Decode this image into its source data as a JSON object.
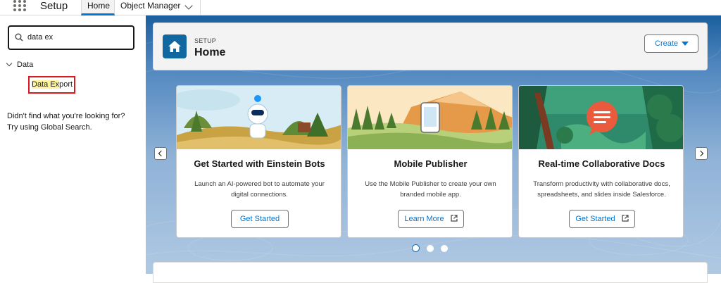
{
  "topbar": {
    "app_name": "Setup",
    "tabs": [
      {
        "label": "Home",
        "active": true
      },
      {
        "label": "Object Manager",
        "has_dropdown": true
      }
    ]
  },
  "sidebar": {
    "search": {
      "value": "data ex"
    },
    "tree": {
      "parent_label": "Data",
      "child_label_match": "Data Ex",
      "child_label_rest": "port"
    },
    "help_line1": "Didn't find what you're looking for?",
    "help_line2": "Try using Global Search."
  },
  "header": {
    "eyebrow": "SETUP",
    "title": "Home",
    "create_label": "Create"
  },
  "cards": [
    {
      "title": "Get Started with Einstein Bots",
      "desc": "Launch an AI-powered bot to automate your digital connections.",
      "button": "Get Started",
      "external": false
    },
    {
      "title": "Mobile Publisher",
      "desc": "Use the Mobile Publisher to create your own branded mobile app.",
      "button": "Learn More",
      "external": true
    },
    {
      "title": "Real-time Collaborative Docs",
      "desc": "Transform productivity with collaborative docs, spreadsheets, and slides inside Salesforce.",
      "button": "Get Started",
      "external": true
    }
  ],
  "carousel": {
    "total_pages": 3,
    "active_page": 1
  },
  "colors": {
    "brand_blue": "#0176d3",
    "highlight": "#fff59d",
    "annotation_red": "#e0171a"
  }
}
